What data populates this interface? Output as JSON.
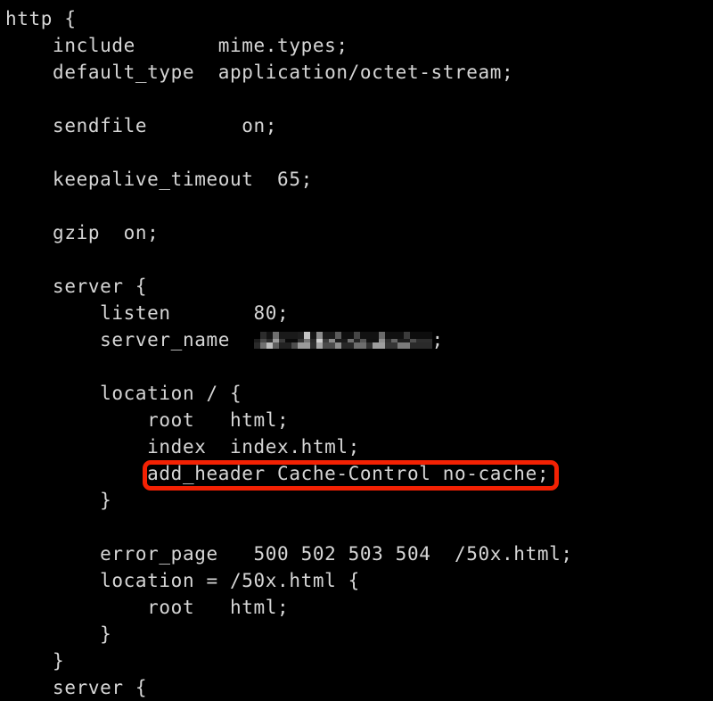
{
  "terminal": {
    "background_color": "#000000",
    "text_color": "#d6d6d6",
    "font_size_px": 21,
    "line_height_px": 30
  },
  "annotation": {
    "type": "rounded-rectangle-highlight",
    "color": "#f32103",
    "target_line_index": 17,
    "target_text": "add_header Cache-Control no-cache;"
  },
  "config": {
    "filename_context": "nginx http block",
    "lines": [
      {
        "index": 0,
        "text": "http {"
      },
      {
        "index": 1,
        "text": "    include       mime.types;"
      },
      {
        "index": 2,
        "text": "    default_type  application/octet-stream;"
      },
      {
        "index": 3,
        "text": ""
      },
      {
        "index": 4,
        "text": "    sendfile        on;"
      },
      {
        "index": 5,
        "text": ""
      },
      {
        "index": 6,
        "text": "    keepalive_timeout  65;"
      },
      {
        "index": 7,
        "text": ""
      },
      {
        "index": 8,
        "text": "    gzip  on;"
      },
      {
        "index": 9,
        "text": ""
      },
      {
        "index": 10,
        "text": "    server {"
      },
      {
        "index": 11,
        "text": "        listen       80;"
      },
      {
        "index": 12,
        "text": "        server_name  "
      },
      {
        "index": 13,
        "text": ""
      },
      {
        "index": 14,
        "text": "        location / {"
      },
      {
        "index": 15,
        "text": "            root   html;"
      },
      {
        "index": 16,
        "text": "            index  index.html;"
      },
      {
        "index": 17,
        "text": "            add_header Cache-Control no-cache;"
      },
      {
        "index": 18,
        "text": "        }"
      },
      {
        "index": 19,
        "text": ""
      },
      {
        "index": 20,
        "text": "        error_page   500 502 503 504  /50x.html;"
      },
      {
        "index": 21,
        "text": "        location = /50x.html {"
      },
      {
        "index": 22,
        "text": "            root   html;"
      },
      {
        "index": 23,
        "text": "        }"
      },
      {
        "index": 24,
        "text": "    }"
      },
      {
        "index": 25,
        "text": "    server {"
      }
    ],
    "server_name_line": {
      "prefix": "        server_name  ",
      "value_redacted": true,
      "suffix": ";"
    }
  }
}
